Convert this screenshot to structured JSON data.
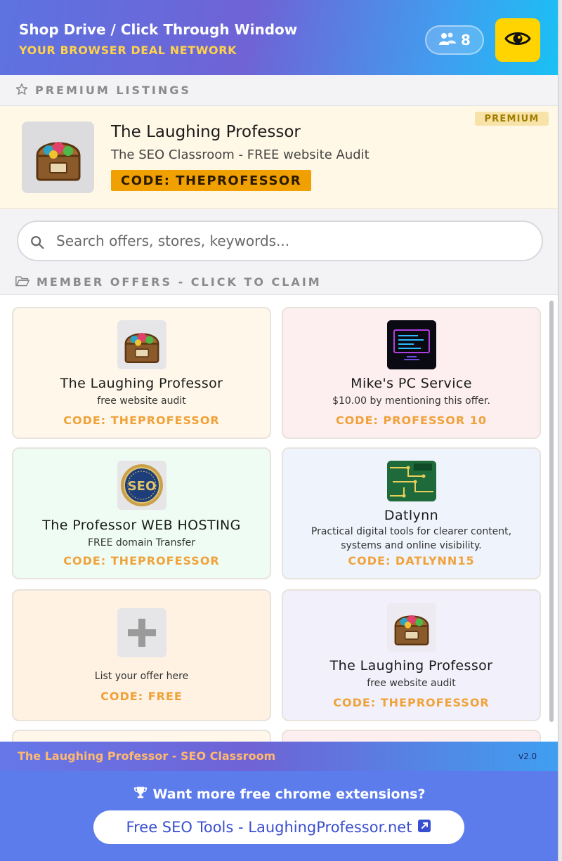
{
  "header": {
    "title": "Shop Drive / Click Through Window",
    "subtitle": "YOUR BROWSER DEAL NETWORK",
    "member_count": "8",
    "icons": {
      "members": "users-icon",
      "toggle": "eye-icon"
    }
  },
  "premium": {
    "section_label": "PREMIUM LISTINGS",
    "badge": "PREMIUM",
    "listing": {
      "name": "The Laughing Professor",
      "description": "The SEO Classroom - FREE website Audit",
      "code": "CODE: THEPROFESSOR",
      "logo": "treasure-chest-logo"
    }
  },
  "search": {
    "placeholder": "Search offers, stores, keywords...",
    "value": ""
  },
  "offers": {
    "section_label": "MEMBER OFFERS - CLICK TO CLAIM",
    "items": [
      {
        "name": "The Laughing Professor",
        "description": "free website audit",
        "code": "CODE: THEPROFESSOR",
        "logo": "treasure-chest-logo",
        "bg": "#fff8ea"
      },
      {
        "name": "Mike's PC Service",
        "description": "$10.00 by mentioning this offer.",
        "code": "CODE: PROFESSOR 10",
        "logo": "computer-monitor-logo",
        "bg": "#fdeef0"
      },
      {
        "name": "The Professor WEB HOSTING",
        "description": "FREE domain Transfer",
        "code": "CODE: THEPROFESSOR",
        "logo": "seo-badge-logo",
        "bg": "#eefcf3"
      },
      {
        "name": "Datlynn",
        "description": "Practical digital tools for clearer content, systems and online visibility.",
        "code": "CODE: DATLYNN15",
        "logo": "circuit-board-logo",
        "bg": "#eff3fb"
      },
      {
        "name": "",
        "description": "List your offer here",
        "code": "CODE: FREE",
        "logo": "plus-icon",
        "bg": "#fff2e2"
      },
      {
        "name": "The Laughing Professor",
        "description": "free website audit",
        "code": "CODE: THEPROFESSOR",
        "logo": "treasure-chest-logo",
        "bg": "#f1f0fb"
      }
    ]
  },
  "footer": {
    "site_name": "The Laughing Professor - SEO Classroom",
    "version": "v2.0",
    "prompt": "Want more free chrome extensions?",
    "link_label": "Free SEO Tools - LaughingProfessor.net",
    "icons": {
      "prompt": "trophy-icon",
      "link": "external-link-icon"
    }
  },
  "colors": {
    "header_gradient_start": "#5d73e0",
    "header_gradient_end": "#19c1f5",
    "accent_yellow": "#ffd400",
    "code_orange": "#f0a23a",
    "premium_code_bg": "#f0a000",
    "footer_bg": "#5d7cec"
  }
}
